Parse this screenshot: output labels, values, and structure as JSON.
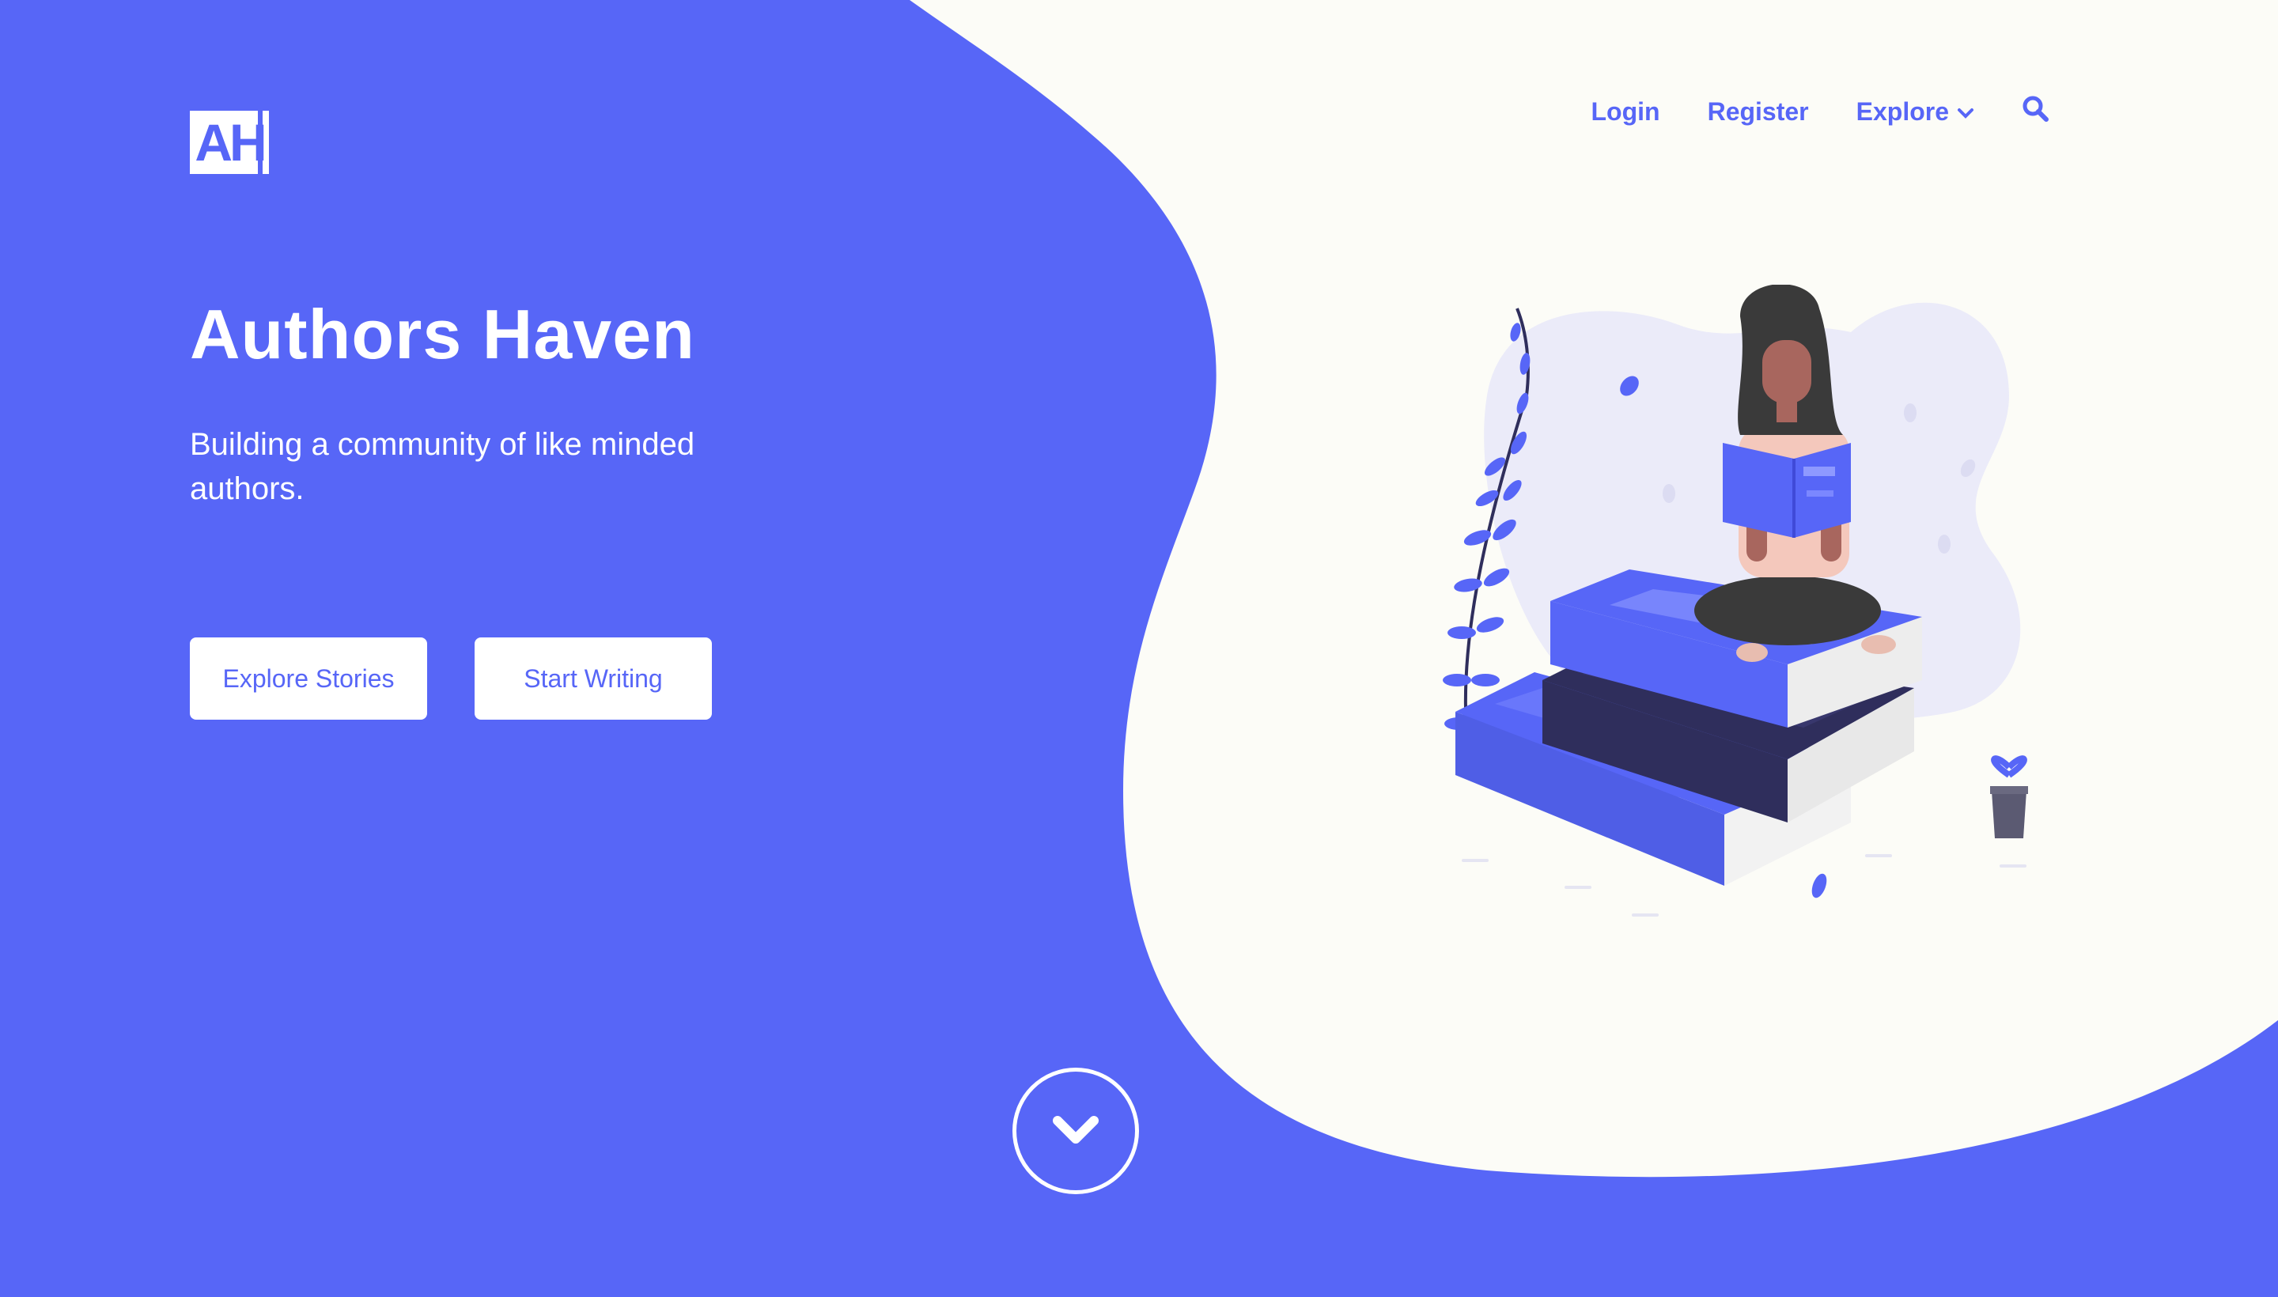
{
  "brand": {
    "logo_text": "AH"
  },
  "nav": {
    "login": "Login",
    "register": "Register",
    "explore": "Explore",
    "search_icon": "search-icon",
    "explore_dropdown_icon": "chevron-down-icon"
  },
  "hero": {
    "title": "Authors Haven",
    "subtitle": "Building a community of like minded authors.",
    "explore_button": "Explore Stories",
    "write_button": "Start Writing",
    "scroll_icon": "chevron-down-icon",
    "illustration": "woman-reading-on-books"
  },
  "colors": {
    "accent": "#5766f7",
    "background_light": "#fcfcf7",
    "book_dark": "#2f2e5c",
    "skin": "#a8665e",
    "hair": "#3a3a3a"
  }
}
